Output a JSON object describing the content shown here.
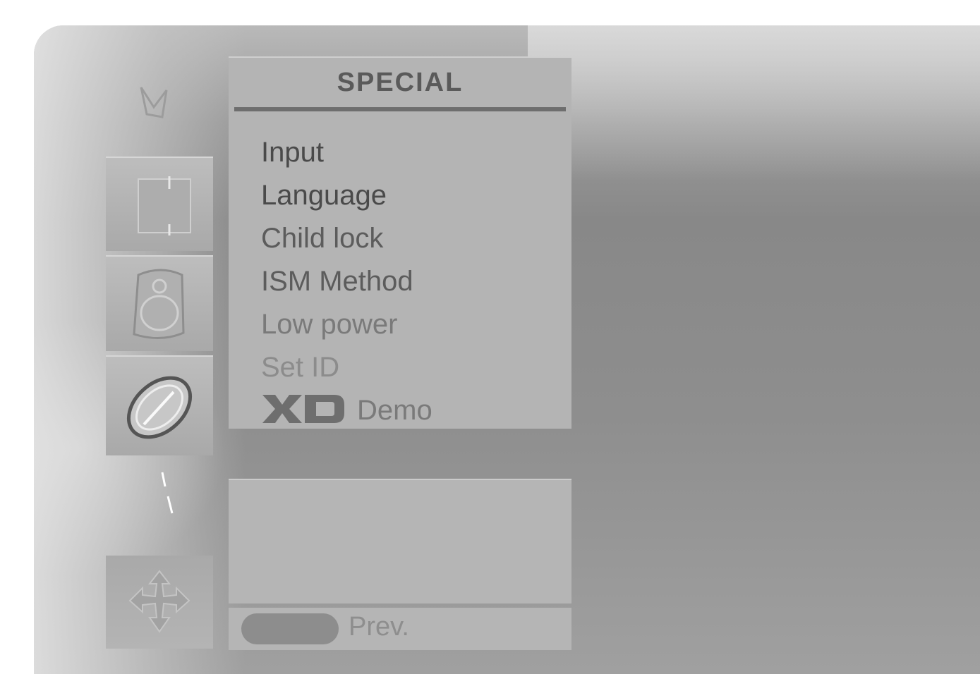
{
  "menu": {
    "title": "SPECIAL",
    "items": [
      {
        "label": "Input"
      },
      {
        "label": "Language"
      },
      {
        "label": "Child lock"
      },
      {
        "label": "ISM Method"
      },
      {
        "label": "Low power"
      },
      {
        "label": "Set ID"
      },
      {
        "label": "Demo",
        "logo": "XD"
      }
    ]
  },
  "sidebar": {
    "icons": [
      "tv-icon",
      "screen-icon",
      "audio-icon",
      "time-icon",
      "option-icon",
      "special-icon"
    ]
  },
  "footer": {
    "prev_label": "Prev."
  }
}
